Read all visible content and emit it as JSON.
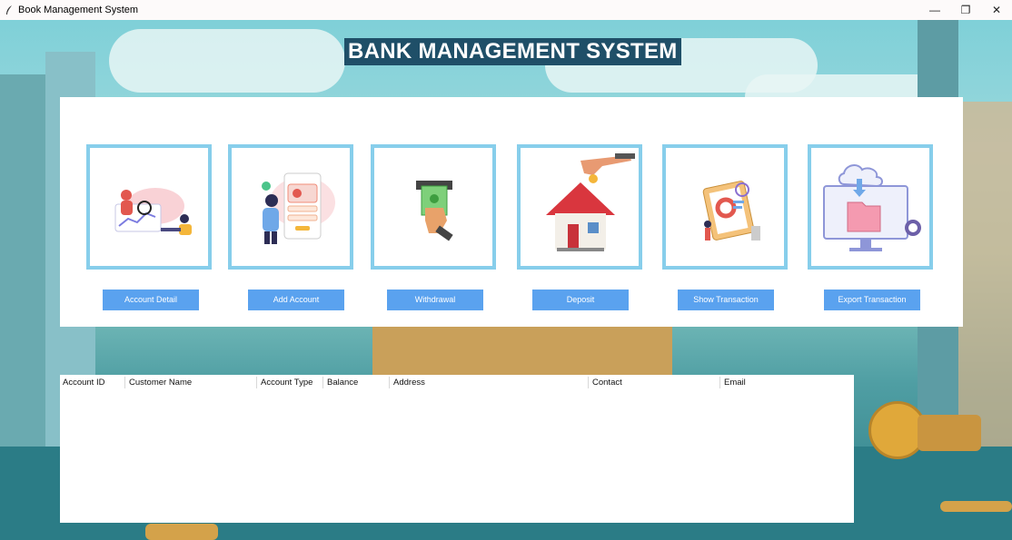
{
  "window": {
    "title": "Book Management System",
    "minimize_icon": "minimize-icon",
    "restore_icon": "restore-icon",
    "close_icon": "close-icon"
  },
  "header": {
    "title": "BANK MANAGEMENT SYSTEM"
  },
  "actions": [
    {
      "label": "Account Detail",
      "icon": "analytics-person-icon"
    },
    {
      "label": "Add Account",
      "icon": "add-profile-icon"
    },
    {
      "label": "Withdrawal",
      "icon": "cash-hand-icon"
    },
    {
      "label": "Deposit",
      "icon": "house-coin-icon"
    },
    {
      "label": "Show Transaction",
      "icon": "clipboard-report-icon"
    },
    {
      "label": "Export Transaction",
      "icon": "cloud-export-icon"
    }
  ],
  "table": {
    "columns": [
      "Account ID",
      "Customer Name",
      "Account Type",
      "Balance",
      "Address",
      "Contact",
      "Email"
    ],
    "rows": []
  },
  "colors": {
    "accent": "#5aa2ef",
    "card_border": "#87ceeb",
    "title_bg": "#1f4f68"
  }
}
